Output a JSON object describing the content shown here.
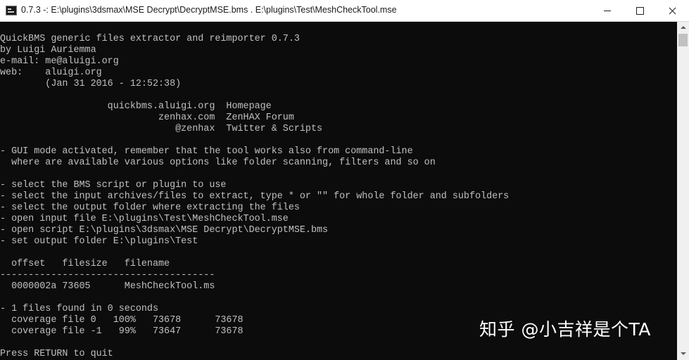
{
  "window": {
    "title": "0.7.3 -: E:\\plugins\\3dsmax\\MSE Decrypt\\DecryptMSE.bms . E:\\plugins\\Test\\MeshCheckTool.mse",
    "icon": "console-app-icon",
    "controls": {
      "minimize": "minimize-icon",
      "maximize": "maximize-icon",
      "close": "close-icon"
    }
  },
  "console": {
    "lines": [
      "QuickBMS generic files extractor and reimporter 0.7.3",
      "by Luigi Auriemma",
      "e-mail: me@aluigi.org",
      "web:    aluigi.org",
      "        (Jan 31 2016 - 12:52:38)",
      "",
      "                   quickbms.aluigi.org  Homepage",
      "                            zenhax.com  ZenHAX Forum",
      "                               @zenhax  Twitter & Scripts",
      "",
      "- GUI mode activated, remember that the tool works also from command-line",
      "  where are available various options like folder scanning, filters and so on",
      "",
      "- select the BMS script or plugin to use",
      "- select the input archives/files to extract, type * or \"\" for whole folder and subfolders",
      "- select the output folder where extracting the files",
      "- open input file E:\\plugins\\Test\\MeshCheckTool.mse",
      "- open script E:\\plugins\\3dsmax\\MSE Decrypt\\DecryptMSE.bms",
      "- set output folder E:\\plugins\\Test",
      "",
      "  offset   filesize   filename",
      "--------------------------------------",
      "  0000002a 73605      MeshCheckTool.ms",
      "",
      "- 1 files found in 0 seconds",
      "  coverage file 0   100%   73678      73678",
      "  coverage file -1   99%   73647      73678",
      "",
      "Press RETURN to quit"
    ]
  },
  "watermark": {
    "text": "知乎 @小吉祥是个TA"
  },
  "colors": {
    "console_bg": "#0c0c0c",
    "console_text": "#c0c0c0",
    "titlebar_bg": "#ffffff",
    "scrollbar_bg": "#f0f0f0",
    "scroll_thumb": "#c1c1c1"
  }
}
